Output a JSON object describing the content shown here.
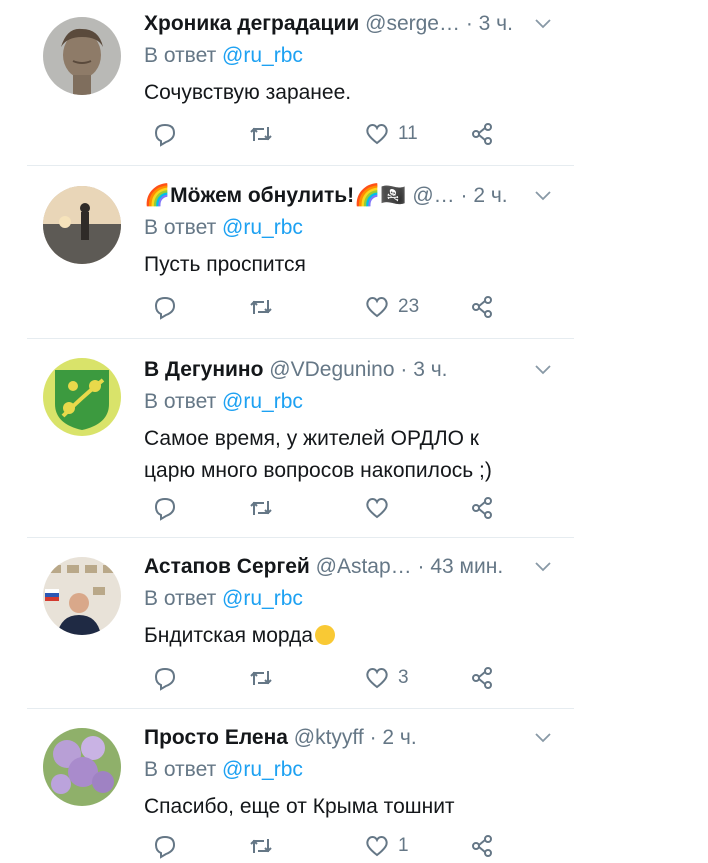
{
  "tweets": [
    {
      "name": "Хроника деградации",
      "handle": "@serge…",
      "dot": "·",
      "time": "3 ч.",
      "reply_prefix": "В ответ",
      "reply_to": "@ru_rbc",
      "text": "Сочувствую заранее.",
      "likes": "11",
      "avatar": "roman-bust"
    },
    {
      "name": "🌈Мӧжем обнулить!🌈🏴‍☠️",
      "handle": "@…",
      "dot": "·",
      "time": "2 ч.",
      "reply_prefix": "В ответ",
      "reply_to": "@ru_rbc",
      "text": "Пусть проспится",
      "likes": "23",
      "avatar": "person-at-sunset"
    },
    {
      "name": "В Дегунино",
      "handle": "@VDegunino",
      "dot": "·",
      "time": "3 ч.",
      "reply_prefix": "В ответ",
      "reply_to": "@ru_rbc",
      "text": "Самое время, у жителей ОРДЛО к\nцарю много вопросов накопилось ;)",
      "likes": "",
      "avatar": "green-clover-emblem"
    },
    {
      "name": "Астапов Сергей",
      "handle": "@Astap…",
      "dot": "·",
      "time": "43 мин.",
      "reply_prefix": "В ответ",
      "reply_to": "@ru_rbc",
      "text": "Бндитская морда",
      "likes": "3",
      "avatar": "man-at-press-wall"
    },
    {
      "name": "Просто Елена",
      "handle": "@ktyyff",
      "dot": "·",
      "time": "2 ч.",
      "reply_prefix": "В ответ",
      "reply_to": "@ru_rbc",
      "text": "Спасибо, еще от Крыма тошнит",
      "likes": "1",
      "avatar": "lilac-flowers"
    }
  ],
  "icons": {
    "reply": "reply-icon",
    "retweet": "retweet-icon",
    "like": "heart-icon",
    "share": "share-icon",
    "more": "chevron-down-icon",
    "emoji": "grinning-face-emoji"
  },
  "colors": {
    "name": "#14171a",
    "secondary": "#657786",
    "mention": "#1da1f2",
    "divider": "#e6ecf0"
  }
}
